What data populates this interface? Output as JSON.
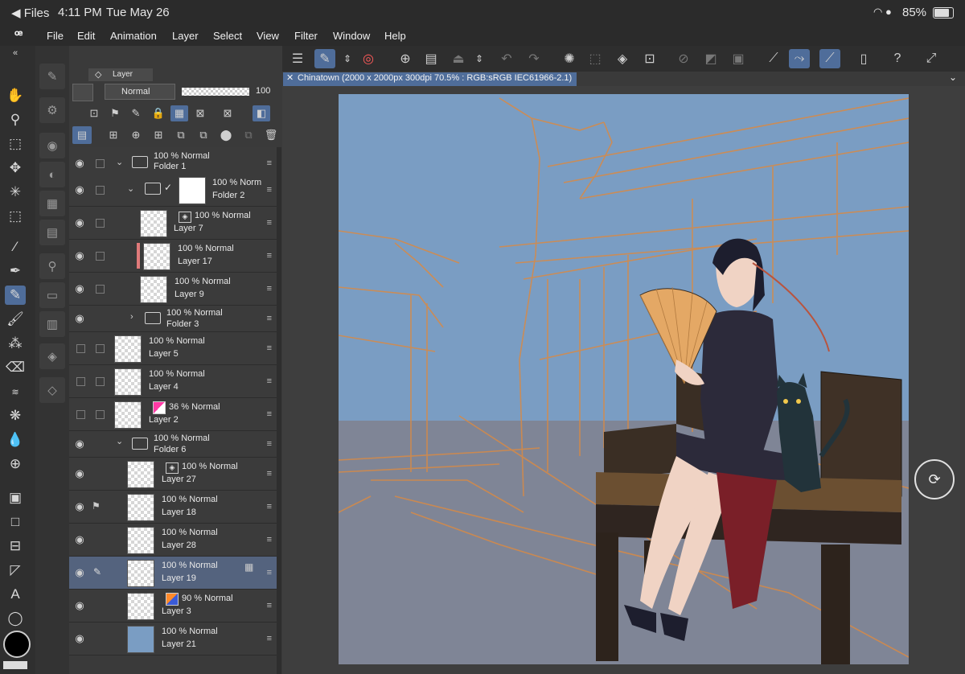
{
  "status_bar": {
    "back_app": "Files",
    "time": "4:11 PM",
    "date": "Tue May 26",
    "battery": "85%"
  },
  "menu": [
    "File",
    "Edit",
    "Animation",
    "Layer",
    "Select",
    "View",
    "Filter",
    "Window",
    "Help"
  ],
  "layer_panel": {
    "tab_label": "Layer",
    "blend_mode": "Normal",
    "opacity_value": "100",
    "layers": [
      {
        "name": "Folder 1",
        "info": "100 % Normal",
        "type": "folder",
        "indent": 0,
        "visible": true,
        "expanded": true
      },
      {
        "name": "Folder 2",
        "info": "100 % Norm",
        "type": "folder",
        "indent": 1,
        "visible": true,
        "expanded": true
      },
      {
        "name": "Layer 7",
        "info": "100 % Normal",
        "type": "layer",
        "indent": 2,
        "visible": true
      },
      {
        "name": "Layer 17",
        "info": "100 % Normal",
        "type": "layer",
        "indent": 2,
        "visible": true
      },
      {
        "name": "Layer 9",
        "info": "100 % Normal",
        "type": "layer",
        "indent": 2,
        "visible": true
      },
      {
        "name": "Folder 3",
        "info": "100 % Normal",
        "type": "folder",
        "indent": 1,
        "visible": true,
        "expanded": false
      },
      {
        "name": "Layer 5",
        "info": "100 % Normal",
        "type": "layer",
        "indent": 0,
        "visible": false
      },
      {
        "name": "Layer 4",
        "info": "100 % Normal",
        "type": "layer",
        "indent": 0,
        "visible": false
      },
      {
        "name": "Layer 2",
        "info": "36 % Normal",
        "type": "layer",
        "indent": 0,
        "visible": false
      },
      {
        "name": "Folder 6",
        "info": "100 % Normal",
        "type": "folder",
        "indent": 0,
        "visible": true,
        "expanded": true
      },
      {
        "name": "Layer 27",
        "info": "100 % Normal",
        "type": "layer",
        "indent": 1,
        "visible": true
      },
      {
        "name": "Layer 18",
        "info": "100 % Normal",
        "type": "layer",
        "indent": 1,
        "visible": true
      },
      {
        "name": "Layer 28",
        "info": "100 % Normal",
        "type": "layer",
        "indent": 1,
        "visible": true
      },
      {
        "name": "Layer 19",
        "info": "100 % Normal",
        "type": "layer",
        "indent": 1,
        "visible": true,
        "selected": true
      },
      {
        "name": "Layer 3",
        "info": "90 % Normal",
        "type": "layer",
        "indent": 1,
        "visible": true
      },
      {
        "name": "Layer 21",
        "info": "100 % Normal",
        "type": "layer",
        "indent": 1,
        "visible": true
      }
    ]
  },
  "document_tab": "Chinatown (2000 x 2000px 300dpi 70.5% : RGB:sRGB IEC61966-2.1)",
  "colors": {
    "sky": "#7a9dc3",
    "floor": "#7f8596",
    "sketch": "#d88a45",
    "accent": "#4f6d9a"
  }
}
